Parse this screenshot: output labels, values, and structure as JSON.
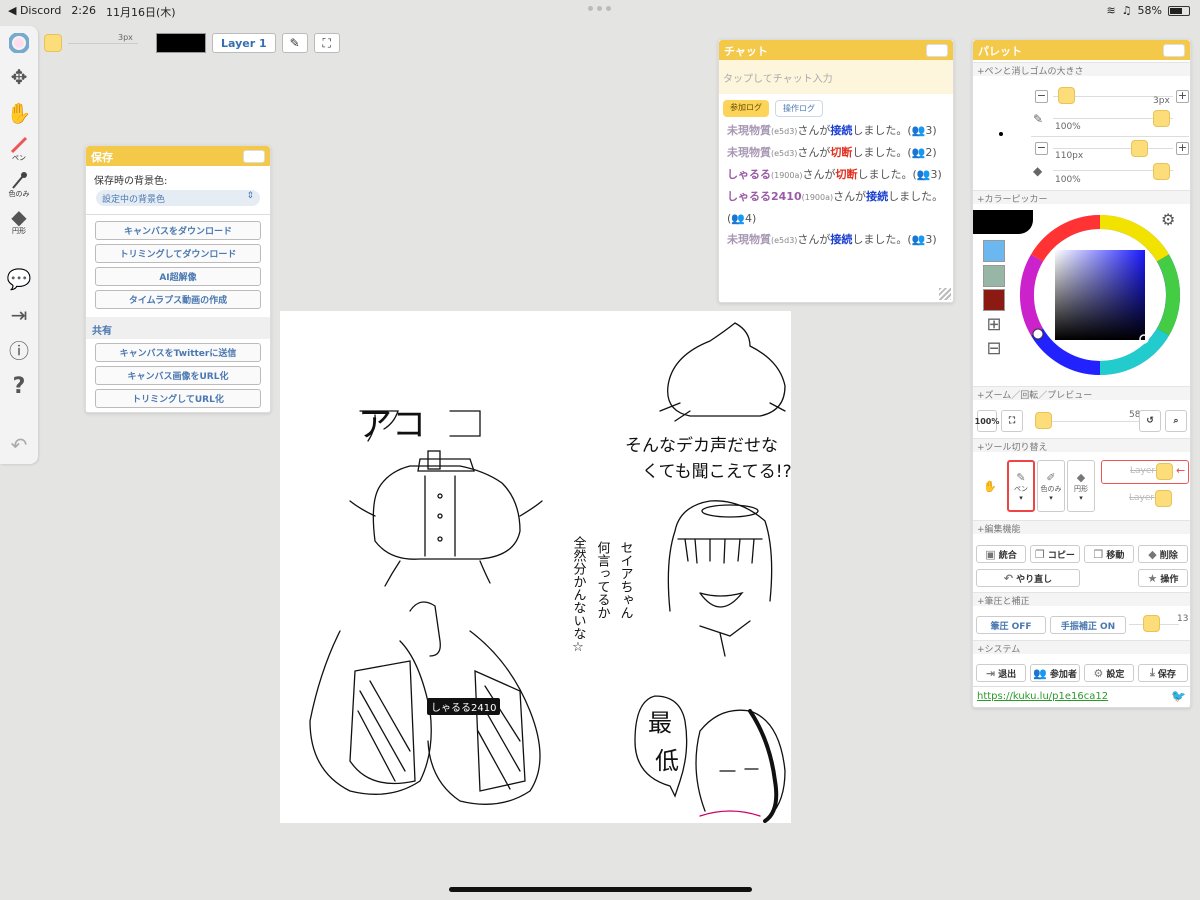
{
  "status": {
    "back_app": "◀ Discord",
    "time": "2:26",
    "date": "11月16日(木)",
    "battery": "58%"
  },
  "toolbar_top": {
    "size": "3px",
    "layer_label": "Layer 1"
  },
  "left_tools": {
    "pen_label": "ペン",
    "picker_label": "色のみ",
    "shape_label": "円形"
  },
  "save_panel": {
    "title": "保存",
    "bg_label": "保存時の背景色:",
    "bg_value": "設定中の背景色",
    "buttons": [
      "キャンバスをダウンロード",
      "トリミングしてダウンロード",
      "AI超解像",
      "タイムラプス動画の作成"
    ],
    "share_heading": "共有",
    "share_buttons": [
      "キャンバスをTwitterに送信",
      "キャンバス画像をURL化",
      "トリミングしてURL化"
    ]
  },
  "chat_panel": {
    "title": "チャット",
    "input_placeholder": "タップしてチャット入力",
    "tab_join": "参加ログ",
    "tab_ops": "操作ログ",
    "messages": [
      {
        "name": "未現物質",
        "hash": "(e5d3)",
        "pre": "さんが",
        "action": "接続",
        "post": "しました。(👥3)"
      },
      {
        "name": "未現物質",
        "hash": "(e5d3)",
        "pre": "さんが",
        "action": "切断",
        "post": "しました。(👥2)"
      },
      {
        "name": "しゃるる",
        "hash": "(1900a)",
        "pre": "さんが",
        "action": "切断",
        "post": "しました。(👥3)"
      },
      {
        "name": "しゃるる2410",
        "hash": "(1900a)",
        "pre": "さんが",
        "action": "接続",
        "post": "しました。(👥4)"
      },
      {
        "name": "未現物質",
        "hash": "(e5d3)",
        "pre": "さんが",
        "action": "接続",
        "post": "しました。(👥3)"
      }
    ]
  },
  "canvas": {
    "cursor_label": "しゃるる2410",
    "text_top": "アコ",
    "text_right1": "そんなデカ声だせな",
    "text_right2": "くても聞こえてる!?",
    "text_vert1": "セイアちゃん",
    "text_vert2": "何言ってるか",
    "text_vert3": "全然分かんないな☆",
    "text_bubble": "最低"
  },
  "palette": {
    "title": "パレット",
    "sec_pen": "+ペンと消しゴムの大きさ",
    "pen_size": "3px",
    "pen_opacity": "100%",
    "eraser_size": "110px",
    "eraser_opacity": "100%",
    "sec_color": "+カラーピッカー",
    "swatches": [
      "#6bb8f0",
      "#97b6a6",
      "#8a1a12"
    ],
    "current_color": "#000000",
    "sec_zoom": "+ズーム／回転／プレビュー",
    "zoom_btn": "100%",
    "zoom_value": "58%",
    "sec_tool": "+ツール切り替え",
    "tool_pen": "ペン",
    "tool_picker": "色のみ",
    "tool_shape": "円形",
    "layer1": "Layer1",
    "layer2": "Layer2",
    "sec_edit": "+編集機能",
    "btn_merge": "統合",
    "btn_copy": "コピー",
    "btn_move": "移動",
    "btn_delete": "削除",
    "btn_redo": "やり直し",
    "btn_ops": "操作",
    "sec_pressure": "+筆圧と補正",
    "btn_pressure": "筆圧 OFF",
    "btn_stab": "手振補正 ON",
    "stab_value": "13",
    "sec_system": "+システム",
    "btn_exit": "退出",
    "btn_members": "参加者",
    "btn_settings": "設定",
    "btn_save": "保存",
    "url": "https://kuku.lu/p1e16ca12"
  }
}
